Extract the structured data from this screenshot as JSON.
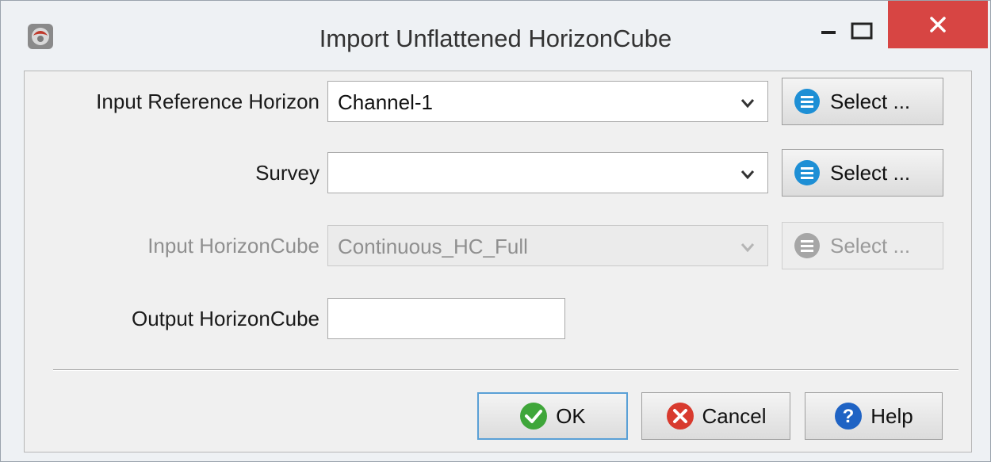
{
  "window": {
    "title": "Import Unflattened HorizonCube",
    "app_icon": "app-logo-icon",
    "controls": [
      "minimize-icon",
      "maximize-icon",
      "close-icon"
    ]
  },
  "form": {
    "reference_horizon": {
      "label": "Input Reference Horizon",
      "value": "Channel-1",
      "select_label": "Select ..."
    },
    "survey": {
      "label": "Survey",
      "value": "",
      "select_label": "Select ..."
    },
    "input_horizoncube": {
      "label": "Input HorizonCube",
      "value": "Continuous_HC_Full",
      "select_label": "Select ...",
      "enabled": false
    },
    "output_horizoncube": {
      "label": "Output HorizonCube",
      "value": ""
    }
  },
  "buttons": {
    "ok": "OK",
    "cancel": "Cancel",
    "help": "Help"
  },
  "colors": {
    "close_bg": "#d74543",
    "select_icon_blue": "#1e8fd5",
    "ok_green": "#3fa63a",
    "cancel_red": "#d83a2e",
    "help_blue": "#1f63c4"
  }
}
